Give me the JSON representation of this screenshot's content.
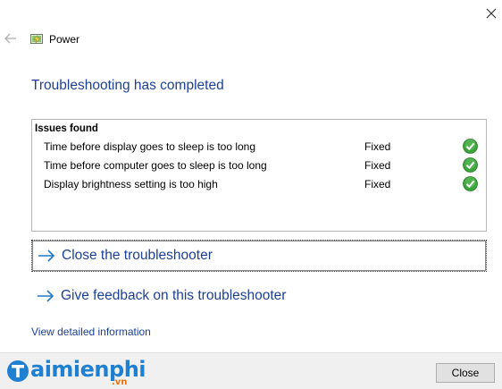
{
  "window": {
    "title": "Power",
    "icons": {
      "close": "close-icon",
      "back": "back-arrow-icon",
      "app": "power-battery-icon"
    }
  },
  "main": {
    "heading": "Troubleshooting has completed",
    "issues": {
      "header": "Issues found",
      "rows": [
        {
          "text": "Time before display goes to sleep is too long",
          "status": "Fixed",
          "icon": "check-icon"
        },
        {
          "text": "Time before computer goes to sleep is too long",
          "status": "Fixed",
          "icon": "check-icon"
        },
        {
          "text": "Display brightness setting is too high",
          "status": "Fixed",
          "icon": "check-icon"
        }
      ]
    },
    "actions": [
      {
        "label": "Close the troubleshooter",
        "icon": "arrow-right-icon"
      },
      {
        "label": "Give feedback on this troubleshooter",
        "icon": "arrow-right-icon"
      }
    ],
    "detail_link": "View detailed information"
  },
  "footer": {
    "close_label": "Close",
    "watermark": {
      "main": "aimienphi",
      "sub": ".vn"
    }
  },
  "colors": {
    "link_blue": "#1c3f94",
    "check_green": "#3aa33a",
    "arrow_blue": "#1f78c8",
    "footer_bg": "#f0f0f0"
  }
}
